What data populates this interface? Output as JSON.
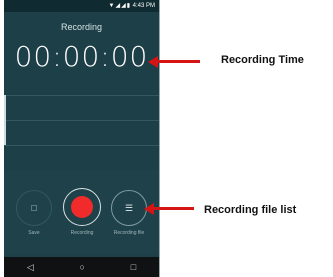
{
  "statusbar": {
    "icons": "▼◢◢▮",
    "time": "4:43 PM"
  },
  "screen": {
    "title": "Recording",
    "timer": "00:00:00"
  },
  "controls": {
    "save_label": "Save",
    "record_label": "Recording",
    "file_label": "Recording file"
  },
  "navbar": {
    "back": "◁",
    "home": "○",
    "recents": "□"
  },
  "annotations": {
    "time_label": "Recording Time",
    "list_label": "Recording file list",
    "arrow_color": "#d61414"
  },
  "colors": {
    "background": "#1c3f48",
    "record": "#f12b2b"
  }
}
